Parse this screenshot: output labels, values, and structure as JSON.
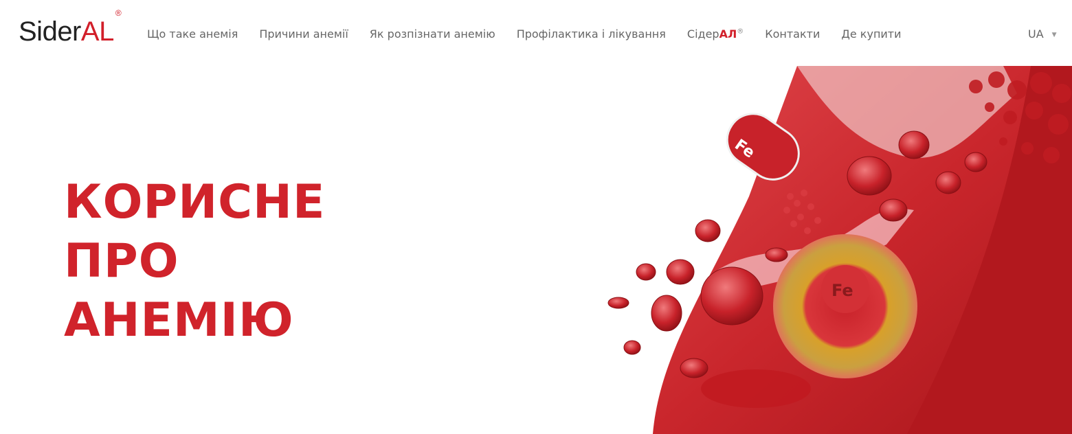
{
  "header": {
    "logo": {
      "prefix": "Sider",
      "accent": "AL",
      "mark": "®"
    },
    "nav": [
      {
        "label": "Що таке анемія"
      },
      {
        "label": "Причини анемії"
      },
      {
        "label": "Як розпізнати анемію"
      },
      {
        "label": "Профілактика і лікування"
      },
      {
        "label_prefix": "Сідер",
        "label_accent": "АЛ",
        "mark": "®"
      },
      {
        "label": "Контакти"
      },
      {
        "label": "Де купити"
      }
    ],
    "language": "UA"
  },
  "hero": {
    "title_lines": [
      "КОРИСНЕ",
      "ПРО",
      "АНЕМІЮ"
    ],
    "image_labels": {
      "capsule": "Fe",
      "liposome": "Fe"
    }
  },
  "colors": {
    "brand_red": "#d21f2a",
    "nav_text": "#666666"
  }
}
